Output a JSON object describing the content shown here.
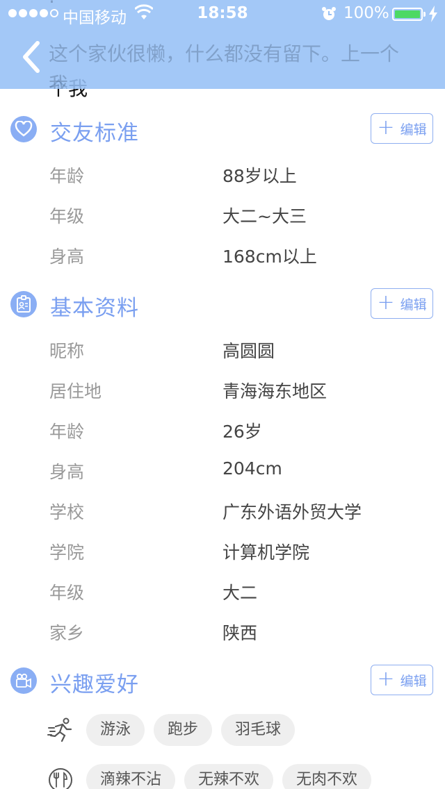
{
  "status_bar": {
    "carrier": "中国移动",
    "time": "18:58",
    "battery": "100%"
  },
  "header": {
    "signature_text": "这个家伙很懒，什么都没有留下。上一个我",
    "partial_line": "个我"
  },
  "edit_label": "编辑",
  "friend_criteria": {
    "title": "交友标准",
    "rows": [
      {
        "label": "年龄",
        "value": "88岁以上"
      },
      {
        "label": "年级",
        "value": "大二~大三"
      },
      {
        "label": "身高",
        "value": "168cm以上"
      }
    ]
  },
  "basic_info": {
    "title": "基本资料",
    "rows": [
      {
        "label": "昵称",
        "value": "高圆圆"
      },
      {
        "label": "居住地",
        "value": "青海海东地区"
      },
      {
        "label": "年龄",
        "value": "26岁"
      },
      {
        "label": "身高",
        "value": "204cm"
      },
      {
        "label": "学校",
        "value": "广东外语外贸大学"
      },
      {
        "label": "学院",
        "value": "计算机学院"
      },
      {
        "label": "年级",
        "value": "大二"
      },
      {
        "label": "家乡",
        "value": "陕西"
      }
    ]
  },
  "hobbies": {
    "title": "兴趣爱好",
    "sports": {
      "icon": "running-icon",
      "tags": [
        "游泳",
        "跑步",
        "羽毛球"
      ]
    },
    "food": {
      "icon": "dining-icon",
      "tags": [
        "滴辣不沾",
        "无辣不欢",
        "无肉不欢"
      ]
    }
  },
  "colors": {
    "header_bg": "#96c0f6",
    "accent": "#7a9ff0",
    "tag_bg": "#efefef",
    "battery": "#4cd964"
  }
}
